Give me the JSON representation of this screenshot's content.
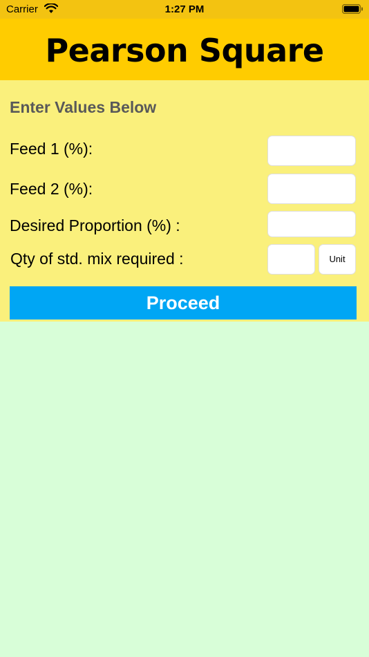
{
  "status_bar": {
    "carrier": "Carrier",
    "time": "1:27 PM"
  },
  "header": {
    "title": "Pearson Square"
  },
  "form": {
    "section_title": "Enter Values Below",
    "feed1_label": "Feed 1 (%):",
    "feed1_value": "",
    "feed2_label": "Feed 2 (%):",
    "feed2_value": "",
    "desired_label": "Desired Proportion (%) :",
    "desired_value": "",
    "qty_label": "Qty of std. mix required :",
    "qty_value": "",
    "unit_label": "Unit",
    "proceed_label": "Proceed"
  },
  "colors": {
    "status_bar": "#f3c311",
    "header": "#ffcc00",
    "form_panel": "#faf07c",
    "page_background": "#d8fed8",
    "proceed_button": "#00a6f4"
  }
}
